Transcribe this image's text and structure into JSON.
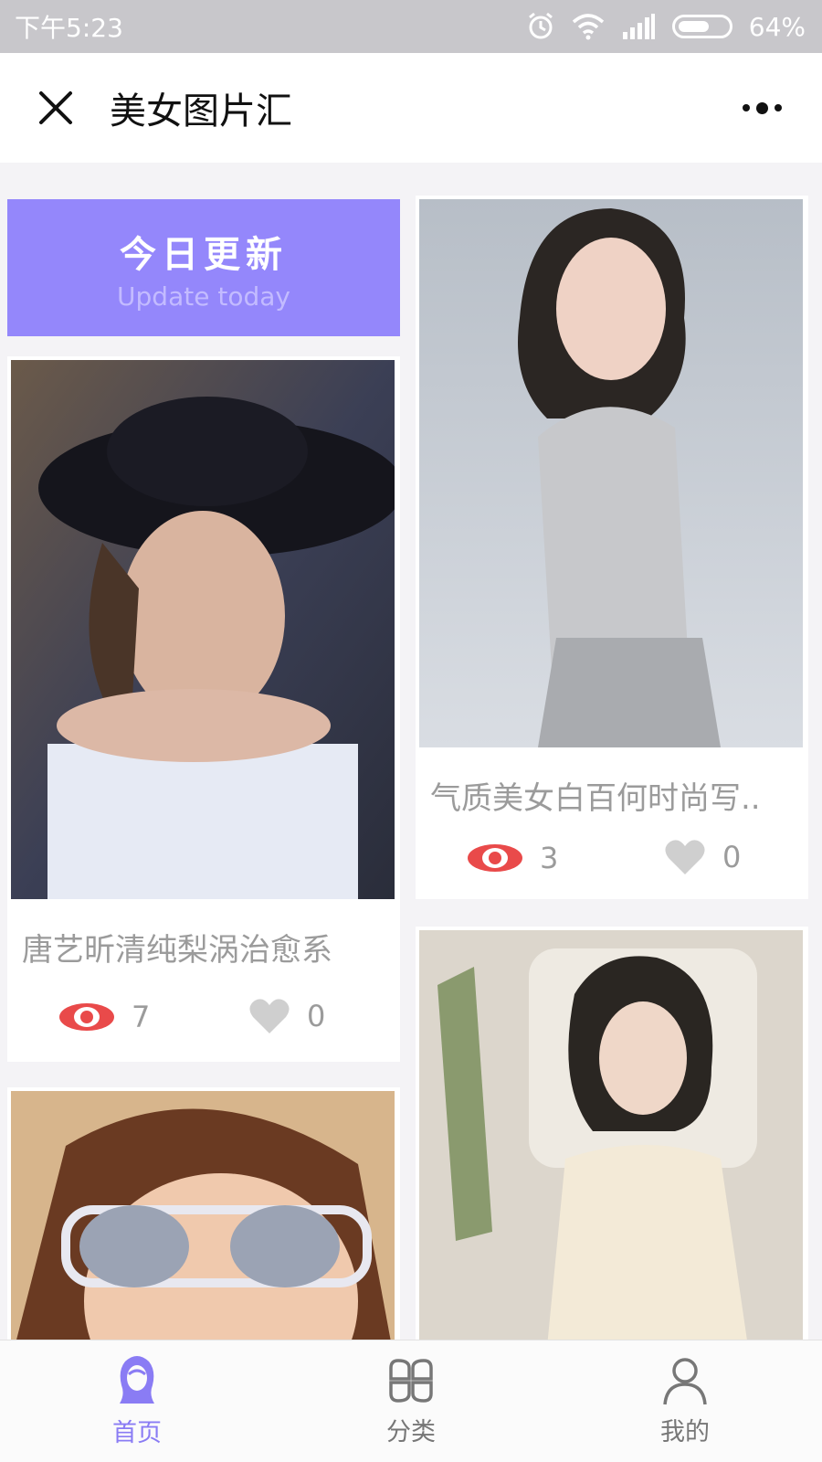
{
  "status_bar": {
    "time": "下午5:23",
    "battery_percent": "64%",
    "battery_level": 0.64,
    "icons": [
      "alarm-icon",
      "wifi-icon",
      "signal-icon",
      "battery-icon"
    ]
  },
  "title_bar": {
    "title": "美女图片汇",
    "close_icon": "close-icon",
    "more_icon": "more-icon"
  },
  "banner": {
    "title": "今日更新",
    "subtitle": "Update today"
  },
  "cards": [
    {
      "caption": "唐艺昕清纯梨涡治愈系",
      "views": "7",
      "likes": "0"
    },
    {
      "caption": "气质美女白百何时尚写..",
      "views": "3",
      "likes": "0"
    },
    {
      "caption": "",
      "views": "",
      "likes": ""
    },
    {
      "caption": "",
      "views": "",
      "likes": ""
    }
  ],
  "tabs": [
    {
      "label": "首页",
      "icon": "girl-icon",
      "active": true
    },
    {
      "label": "分类",
      "icon": "category-icon",
      "active": false
    },
    {
      "label": "我的",
      "icon": "user-icon",
      "active": false
    }
  ],
  "colors": {
    "accent": "#8a7cf4",
    "banner": "#9487fb",
    "view_eye": "#e94a4a",
    "like_heart": "#cfcfcf"
  }
}
